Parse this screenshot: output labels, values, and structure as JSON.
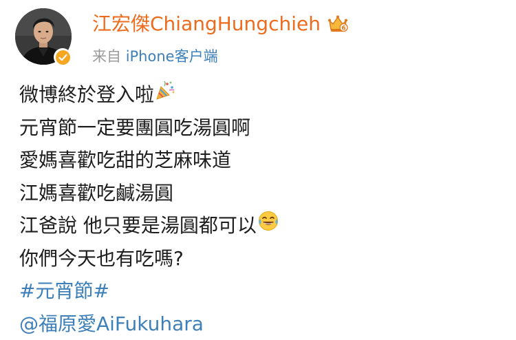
{
  "post": {
    "username": "江宏傑ChiangHungchieh",
    "source_prefix": "来自",
    "source_device": "iPhone客户端",
    "lines": [
      "微博終於登入啦",
      "元宵節一定要團圓吃湯圓啊",
      "愛媽喜歡吃甜的芝麻味道",
      "江媽喜歡吃鹹湯圓",
      "江爸說 他只要是湯圓都可以",
      "你們今天也有吃嗎?"
    ],
    "hashtag": "#元宵節#",
    "mention": "@福原愛AiFukuhara"
  },
  "icons": {
    "vip": "crown-vip-icon",
    "verified": "verified-badge-icon",
    "party": "party-popper-emoji",
    "laugh": "tears-of-joy-emoji"
  },
  "colors": {
    "username": "#ec6b1d",
    "link": "#3d7fb9",
    "source": "#9a9a9a",
    "text": "#1e1e1e",
    "verified": "#f5a623"
  }
}
